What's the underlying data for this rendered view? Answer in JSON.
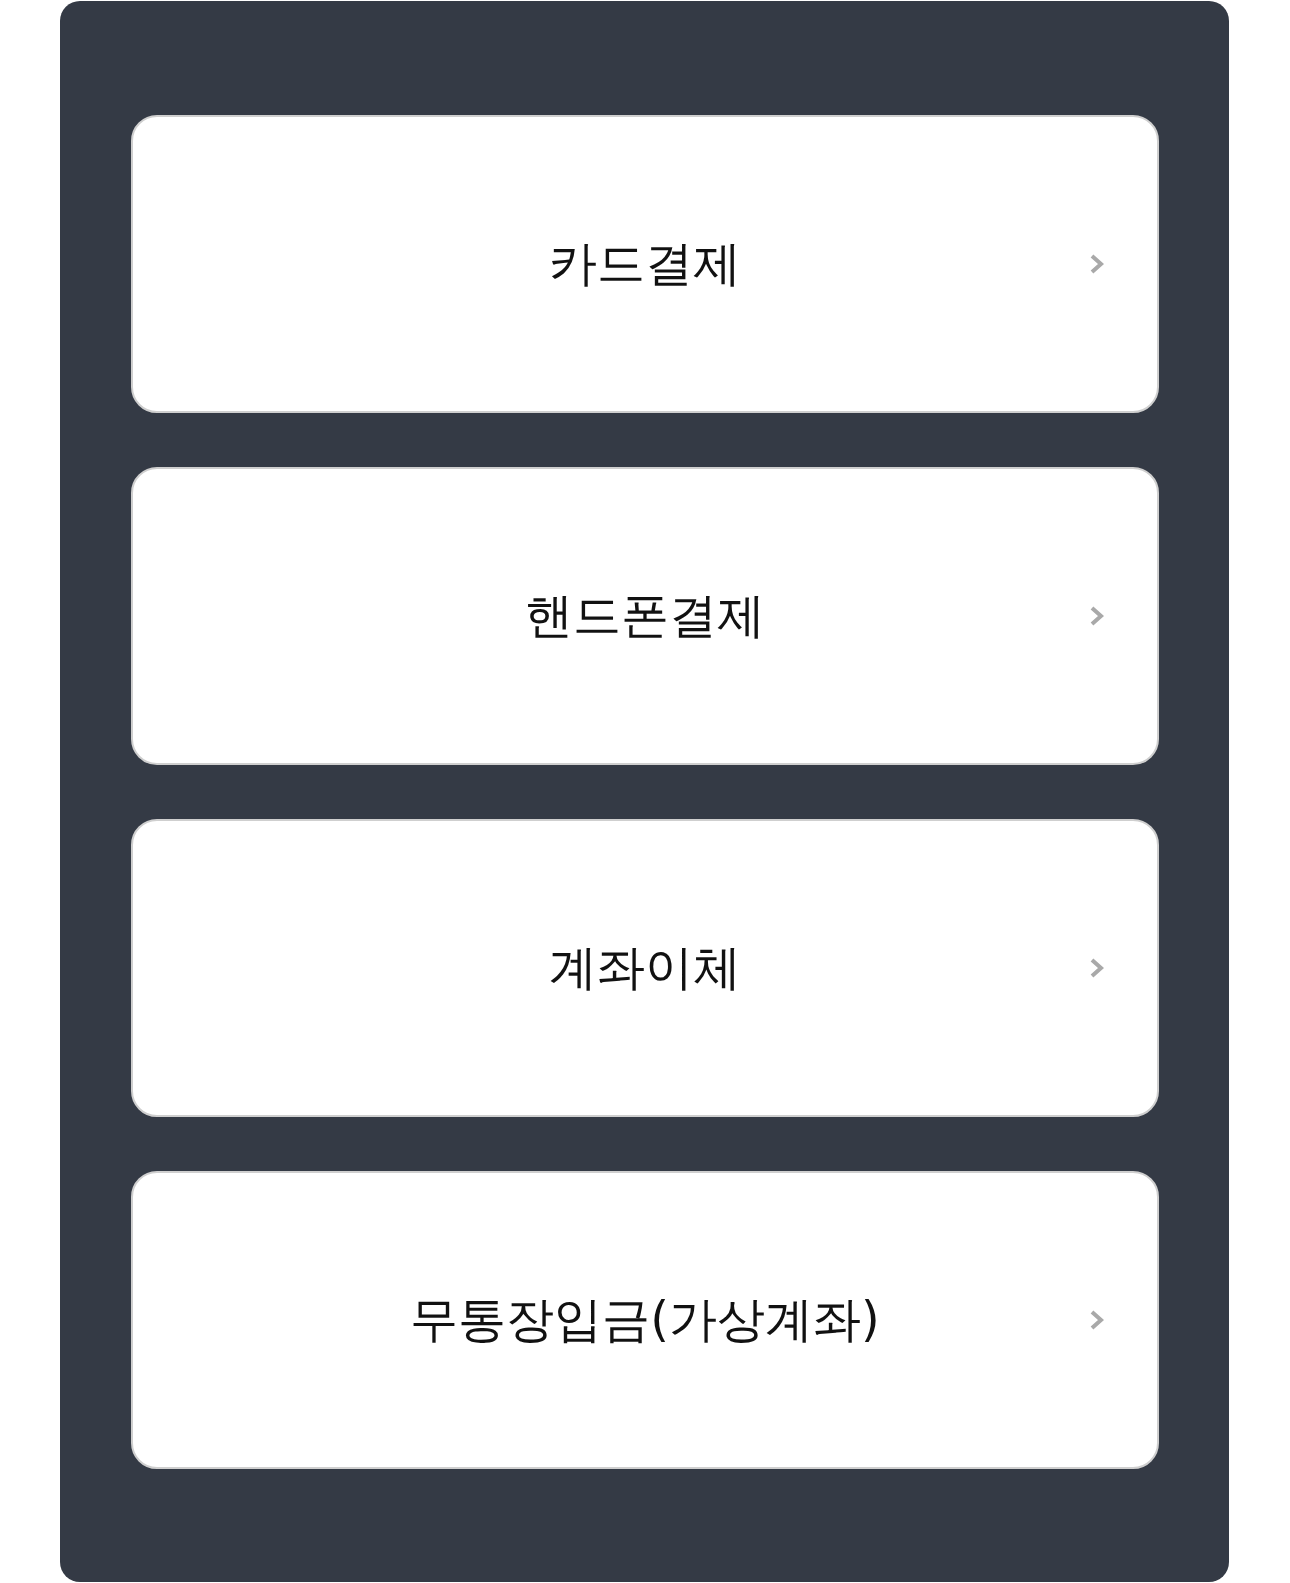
{
  "payment_options": [
    {
      "label": "카드결제"
    },
    {
      "label": "핸드폰결제"
    },
    {
      "label": "계좌이체"
    },
    {
      "label": "무통장입금(가상계좌)"
    }
  ]
}
